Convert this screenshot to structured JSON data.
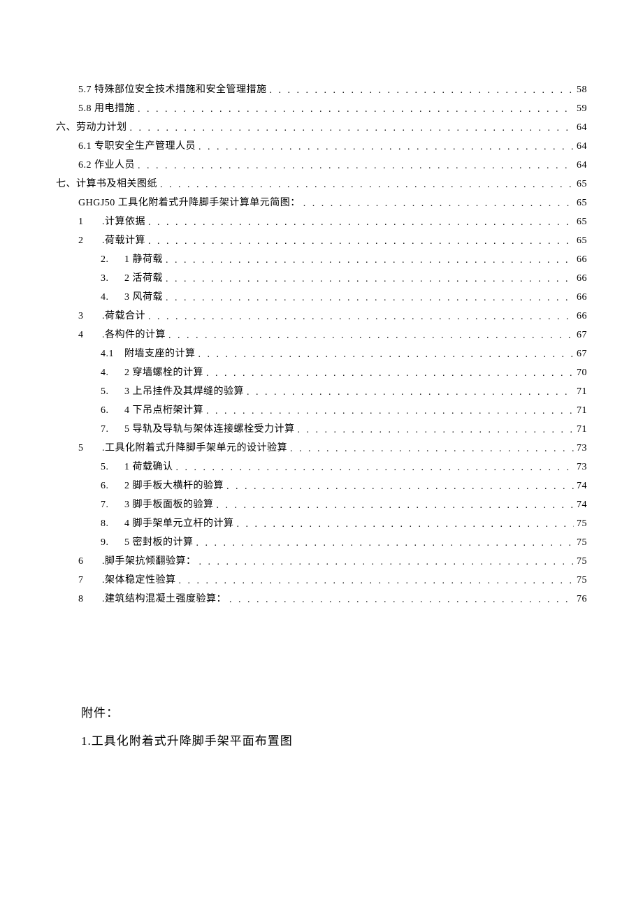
{
  "toc": [
    {
      "indent": 1,
      "num": "",
      "label": "5.7 特殊部位安全技术措施和安全管理措施",
      "page": "58"
    },
    {
      "indent": 1,
      "num": "",
      "label": "5.8 用电措施",
      "page": "59"
    },
    {
      "indent": 0,
      "num": "",
      "label": "六、劳动力计划",
      "page": "64"
    },
    {
      "indent": 1,
      "num": "",
      "label": "6.1 专职安全生产管理人员",
      "page": "64"
    },
    {
      "indent": 1,
      "num": "",
      "label": "6.2 作业人员",
      "page": "64"
    },
    {
      "indent": 0,
      "num": "",
      "label": "七、计算书及相关图纸",
      "page": "65"
    },
    {
      "indent": 1,
      "num": "",
      "label": "GHGJ50 工具化附着式升降脚手架计算单元简图：",
      "page": "65"
    },
    {
      "indent": 2,
      "num": "1",
      "label": ".计算依据",
      "page": "65"
    },
    {
      "indent": 2,
      "num": "2",
      "label": ".荷载计算",
      "page": "65"
    },
    {
      "indent": 3,
      "num": "2.",
      "label": "1 静荷载",
      "page": "66"
    },
    {
      "indent": 3,
      "num": "3.",
      "label": "2 活荷载",
      "page": "66"
    },
    {
      "indent": 3,
      "num": "4.",
      "label": "3 风荷载",
      "page": "66"
    },
    {
      "indent": 2,
      "num": "3",
      "label": ".荷载合计",
      "page": "66"
    },
    {
      "indent": 2,
      "num": "4",
      "label": ".各构件的计算",
      "page": "67"
    },
    {
      "indent": 3,
      "num": "4.1",
      "label": "  附墙支座的计算",
      "page": "67"
    },
    {
      "indent": 3,
      "num": "4.",
      "label": "2 穿墙螺栓的计算",
      "page": "70"
    },
    {
      "indent": 3,
      "num": "5.",
      "label": "3 上吊挂件及其焊缝的验算",
      "page": "71"
    },
    {
      "indent": 3,
      "num": "6.",
      "label": "4 下吊点桁架计算",
      "page": "71"
    },
    {
      "indent": 3,
      "num": "7.",
      "label": "5 导轨及导轨与架体连接螺栓受力计算",
      "page": "71"
    },
    {
      "indent": 2,
      "num": "5",
      "label": ".工具化附着式升降脚手架单元的设计验算",
      "page": "73"
    },
    {
      "indent": 3,
      "num": "5.",
      "label": "1 荷载确认",
      "page": "73"
    },
    {
      "indent": 3,
      "num": "6.",
      "label": "2 脚手板大横杆的验算",
      "page": "74"
    },
    {
      "indent": 3,
      "num": "7.",
      "label": "3 脚手板面板的验算",
      "page": "74"
    },
    {
      "indent": 3,
      "num": "8.",
      "label": "4 脚手架单元立杆的计算",
      "page": "75"
    },
    {
      "indent": 3,
      "num": "9.",
      "label": "5 密封板的计算",
      "page": "75"
    },
    {
      "indent": 2,
      "num": "6",
      "label": ".脚手架抗倾翻验算：",
      "page": "75"
    },
    {
      "indent": 2,
      "num": "7",
      "label": ".架体稳定性验算",
      "page": "75"
    },
    {
      "indent": 2,
      "num": "8",
      "label": ".建筑结构混凝土强度验算：",
      "page": "76"
    }
  ],
  "appendix": {
    "title": "附件：",
    "item1": "1.工具化附着式升降脚手架平面布置图"
  }
}
